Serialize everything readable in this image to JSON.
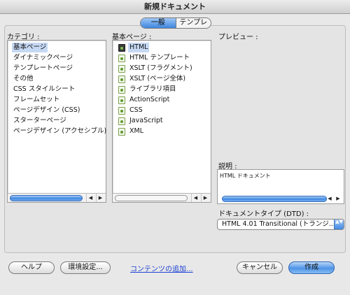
{
  "window": {
    "title": "新規ドキュメント"
  },
  "tabs": [
    {
      "label": "一般",
      "active": true
    },
    {
      "label": "テンプレート",
      "active": false
    }
  ],
  "category": {
    "label": "カテゴリ :",
    "items": [
      "基本ページ",
      "ダイナミックページ",
      "テンプレートページ",
      "その他",
      "CSS スタイルシート",
      "フレームセット",
      "ページデザイン (CSS)",
      "スターターページ",
      "ページデザイン (アクセシブル)"
    ],
    "selected_index": 0
  },
  "basic_page": {
    "label": "基本ページ :",
    "items": [
      "HTML",
      "HTML テンプレート",
      "XSLT (フラグメント)",
      "XSLT (ページ全体)",
      "ライブラリ項目",
      "ActionScript",
      "CSS",
      "JavaScript",
      "XML"
    ],
    "selected_index": 0
  },
  "preview": {
    "label": "プレビュー :"
  },
  "description": {
    "label": "説明 :",
    "text": "HTML ドキュメント"
  },
  "doctype": {
    "label": "ドキュメントタイプ (DTD) :",
    "value": "HTML 4.01 Transitional (トランジ..."
  },
  "footer": {
    "help_label": "ヘルプ",
    "prefs_label": "環境設定...",
    "link_label": "コンテンツの追加...",
    "cancel_label": "キャンセル",
    "create_label": "作成"
  },
  "scroll_arrows": {
    "left": "◀",
    "right": "▶"
  },
  "icons": {
    "dropdown": "▲▼"
  }
}
